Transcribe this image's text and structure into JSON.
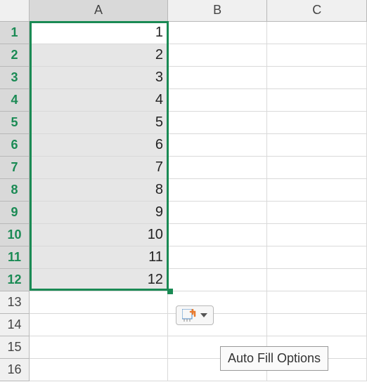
{
  "columns": [
    "A",
    "B",
    "C"
  ],
  "rows": [
    1,
    2,
    3,
    4,
    5,
    6,
    7,
    8,
    9,
    10,
    11,
    12,
    13,
    14,
    15,
    16
  ],
  "cells": {
    "A1": 1,
    "A2": 2,
    "A3": 3,
    "A4": 4,
    "A5": 5,
    "A6": 6,
    "A7": 7,
    "A8": 8,
    "A9": 9,
    "A10": 10,
    "A11": 11,
    "A12": 12
  },
  "selection": {
    "col": "A",
    "startRow": 1,
    "endRow": 12,
    "activeCell": "A1"
  },
  "autofill": {
    "tooltip": "Auto Fill Options"
  },
  "colors": {
    "selectionBorder": "#1a8a54"
  }
}
